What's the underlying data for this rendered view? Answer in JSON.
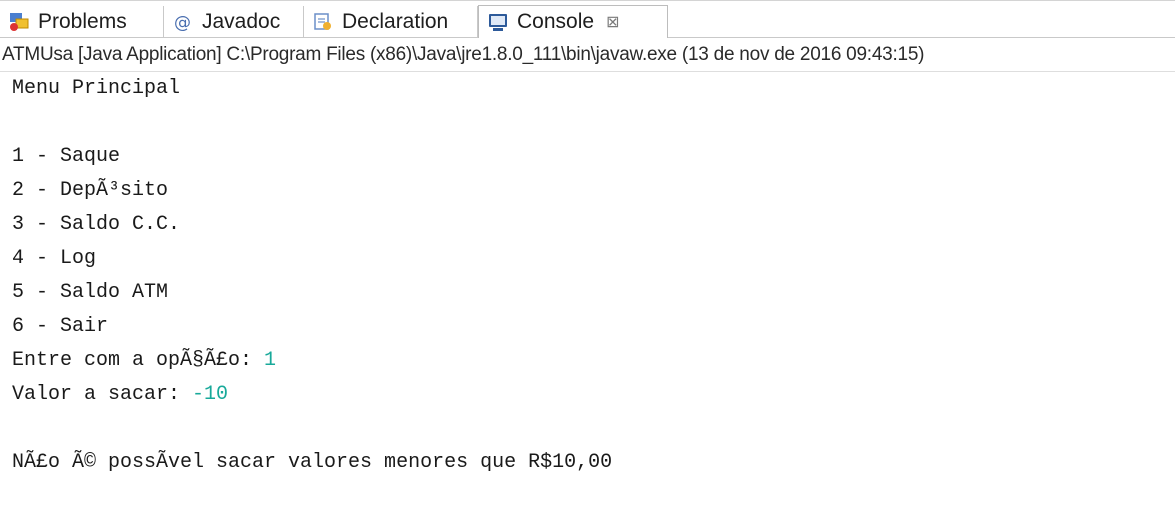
{
  "tabs": [
    {
      "label": "Problems",
      "icon": "problems-icon",
      "active": false
    },
    {
      "label": "Javadoc",
      "icon": "javadoc-at-icon",
      "active": false
    },
    {
      "label": "Declaration",
      "icon": "declaration-icon",
      "active": false
    },
    {
      "label": "Console",
      "icon": "console-icon",
      "active": true,
      "close": "⊠"
    }
  ],
  "subheader": "ATMUsa [Java Application] C:\\Program Files (x86)\\Java\\jre1.8.0_111\\bin\\javaw.exe (13 de nov de 2016 09:43:15)",
  "console": {
    "menu_title": "Menu Principal",
    "options": [
      "1 - Saque",
      "2 - DepÃ³sito",
      "3 - Saldo C.C.",
      "4 - Log",
      "5 - Saldo ATM",
      "6 - Sair"
    ],
    "prompt_option": "Entre com a opÃ§Ã£o: ",
    "input_option": "1",
    "prompt_value": "Valor a sacar: ",
    "input_value": "-10",
    "message": "NÃ£o Ã© possÃ­vel sacar valores menores que R$10,00"
  },
  "colors": {
    "input": "#18a99a"
  }
}
